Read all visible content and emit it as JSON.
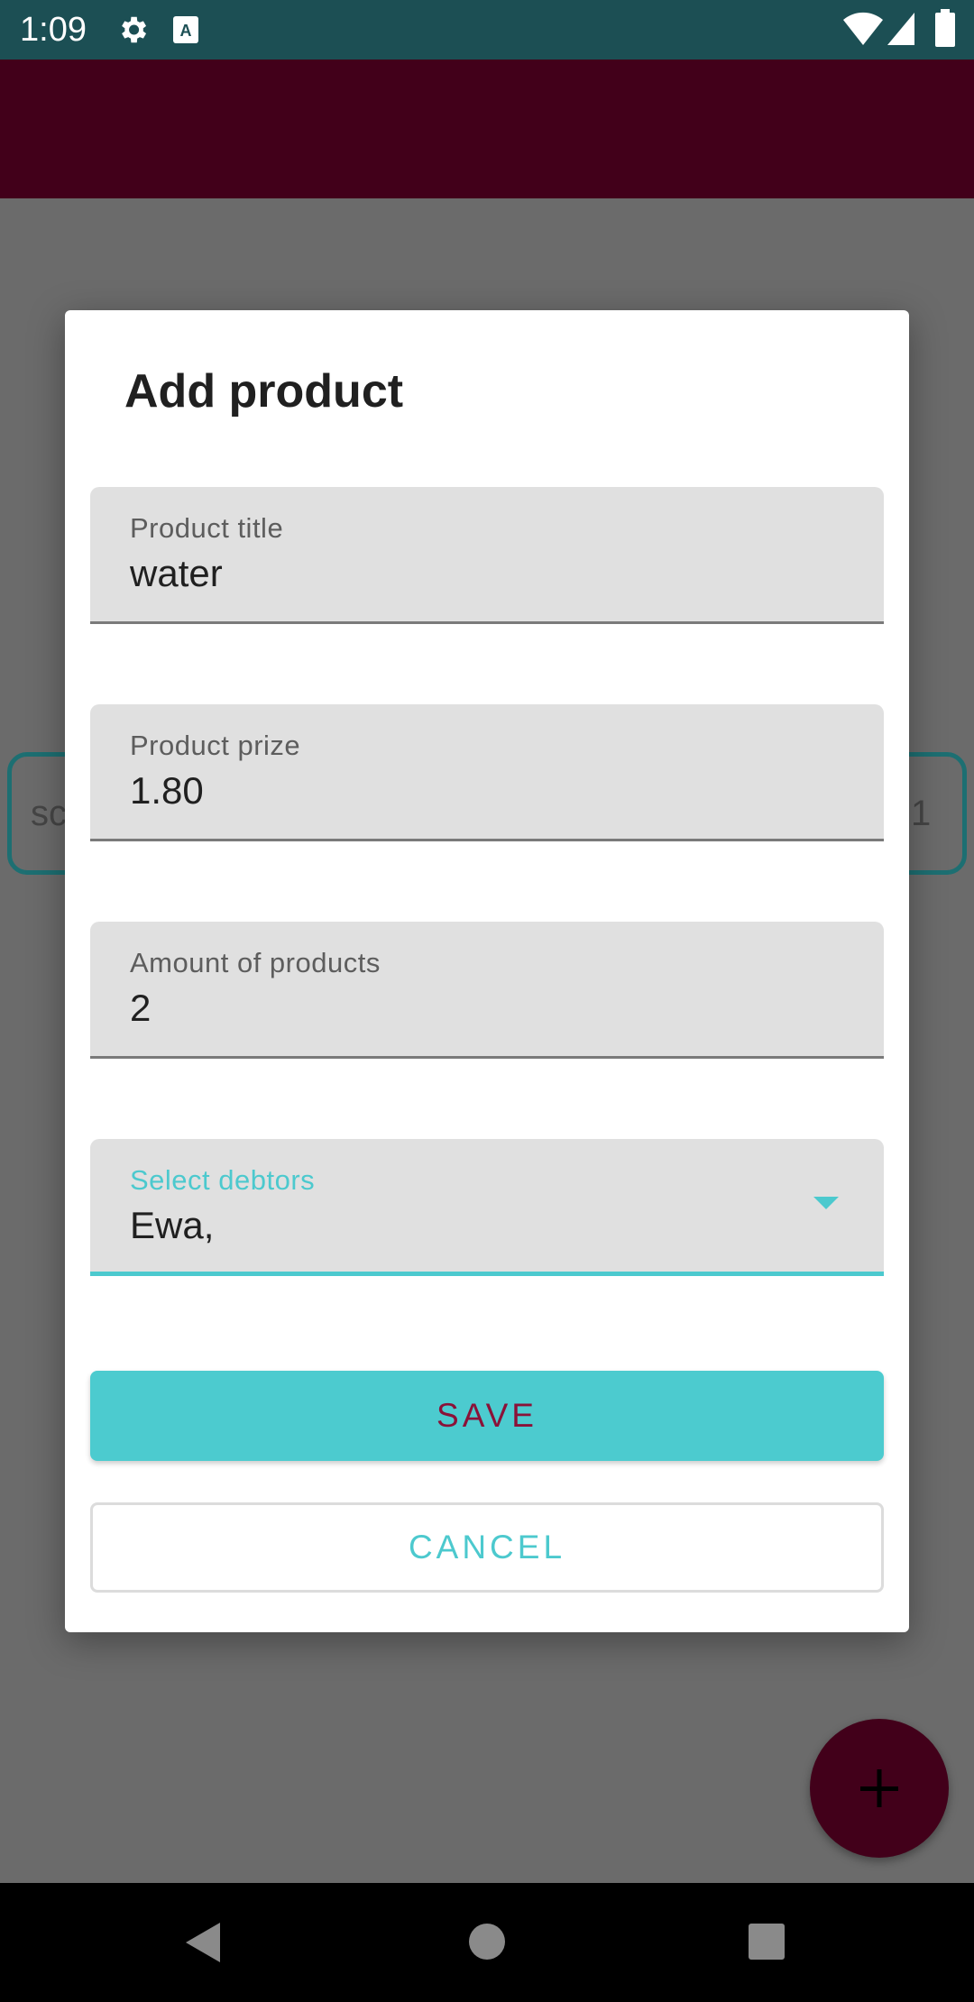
{
  "status_bar": {
    "time": "1:09",
    "icons": [
      "gear-icon",
      "a-icon",
      "wifi-icon",
      "signal-icon",
      "battery-icon"
    ]
  },
  "background": {
    "list_item_left_text": "sc",
    "list_item_right_text": "1"
  },
  "dialog": {
    "title": "Add product",
    "fields": {
      "title": {
        "label": "Product title",
        "value": "water"
      },
      "prize": {
        "label": "Product prize",
        "value": "1.80"
      },
      "amount": {
        "label": "Amount of products",
        "value": "2"
      },
      "debtors": {
        "label": "Select debtors",
        "value": "Ewa,"
      }
    },
    "save_label": "SAVE",
    "cancel_label": "CANCEL"
  },
  "colors": {
    "status_bar": "#1c4f54",
    "app_bar": "#42001a",
    "accent": "#4cc9ce",
    "save_text": "#8a1238",
    "fab": "#42001a"
  }
}
